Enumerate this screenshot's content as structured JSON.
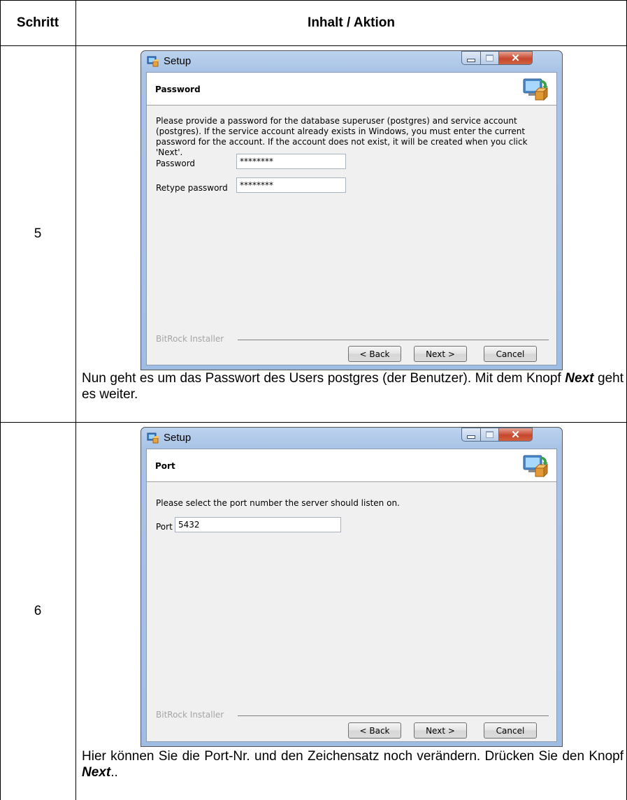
{
  "table": {
    "col_step": "Schritt",
    "col_content": "Inhalt / Aktion"
  },
  "steps": [
    {
      "number": "5",
      "dialog": {
        "title": "Setup",
        "header": "Password",
        "text": "Please provide a password for the database superuser (postgres) and service account (postgres). If the service account already exists in Windows, you must enter the current password for the account. If the account does not exist, it will be created when you click 'Next'.",
        "fields": [
          {
            "label": "Password",
            "value": "********"
          },
          {
            "label": "Retype password",
            "value": "********"
          }
        ],
        "installer": "BitRock Installer",
        "back": "< Back",
        "next": "Next >",
        "cancel": "Cancel"
      },
      "desc_before": "Nun geht es um das Passwort des Users postgres (der Benutzer). Mit dem Knopf ",
      "desc_bold": "Next",
      "desc_after": " geht es weiter."
    },
    {
      "number": "6",
      "dialog": {
        "title": "Setup",
        "header": "Port",
        "text": "Please select the port number the server should listen on.",
        "fields": [
          {
            "label": "Port",
            "value": "5432"
          }
        ],
        "installer": "BitRock Installer",
        "back": "< Back",
        "next": "Next >",
        "cancel": "Cancel"
      },
      "desc_before": "Hier können Sie die Port-Nr. und den Zeichensatz noch verändern. Drücken Sie den Knopf ",
      "desc_bold": "Next",
      "desc_after": ".."
    }
  ]
}
